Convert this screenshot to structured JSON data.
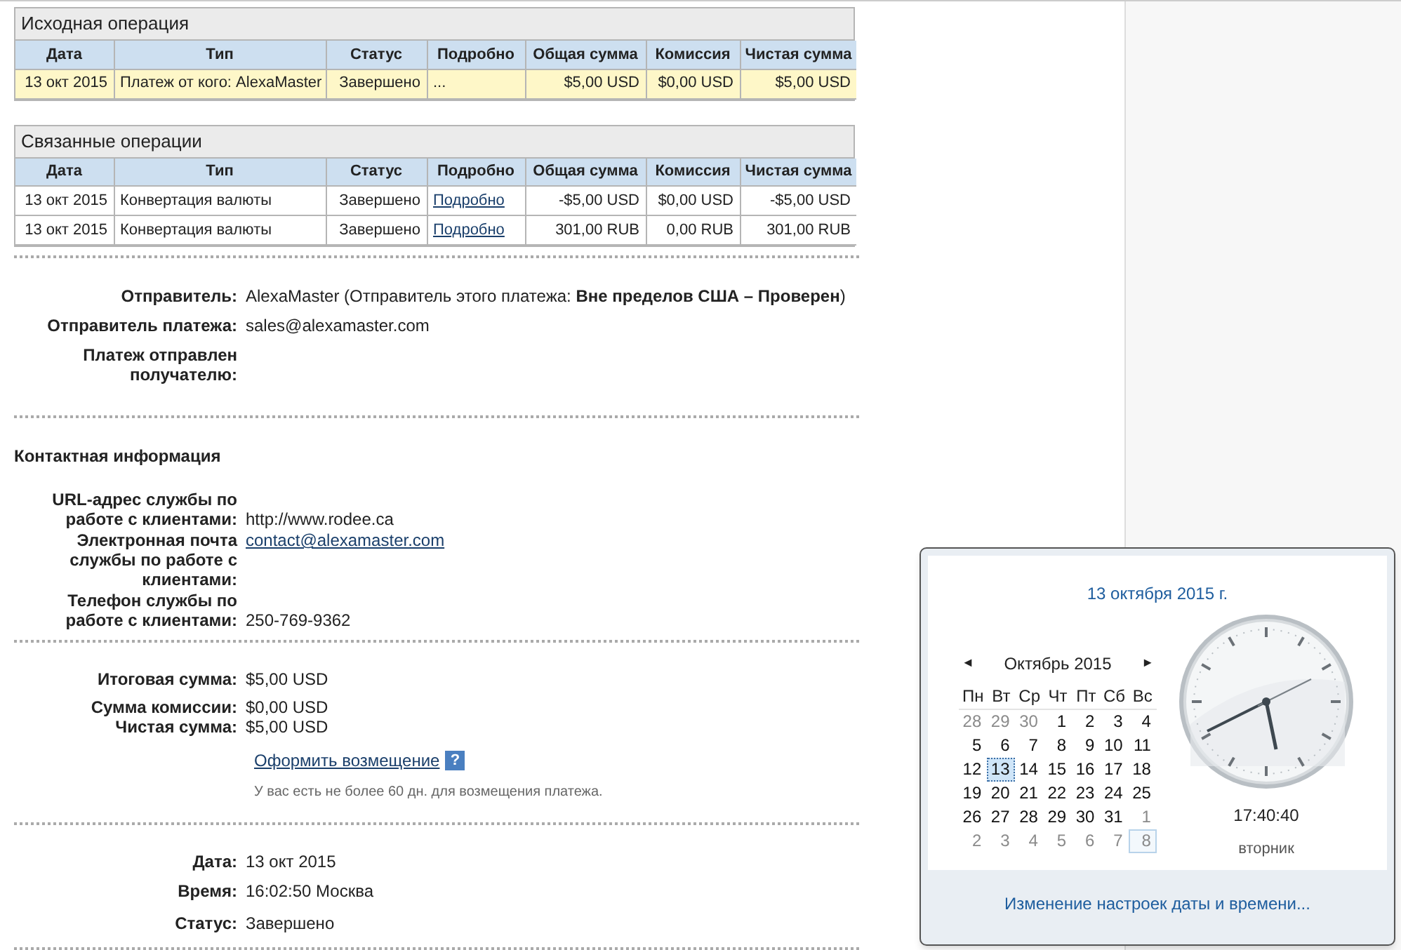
{
  "tables": [
    {
      "title": "Исходная операция",
      "columns": [
        "Дата",
        "Тип",
        "Статус",
        "Подробно",
        "Общая сумма",
        "Комиссия",
        "Чистая сумма"
      ],
      "rows": [
        {
          "selected": true,
          "cells": [
            "13 окт 2015",
            "Платеж от кого: AlexaMaster",
            "Завершено",
            "...",
            "$5,00 USD",
            "$0,00 USD",
            "$5,00 USD"
          ],
          "details_link": false
        }
      ]
    },
    {
      "title": "Связанные операции",
      "columns": [
        "Дата",
        "Тип",
        "Статус",
        "Подробно",
        "Общая сумма",
        "Комиссия",
        "Чистая сумма"
      ],
      "rows": [
        {
          "selected": false,
          "cells": [
            "13 окт 2015",
            "Конвертация валюты",
            "Завершено",
            "Подробно",
            "-$5,00 USD",
            "$0,00 USD",
            "-$5,00 USD"
          ],
          "details_link": true
        },
        {
          "selected": false,
          "cells": [
            "13 окт 2015",
            "Конвертация валюты",
            "Завершено",
            "Подробно",
            "301,00 RUB",
            "0,00 RUB",
            "301,00 RUB"
          ],
          "details_link": true
        }
      ]
    }
  ],
  "sender_section": [
    {
      "label": "Отправитель:",
      "value": "AlexaMaster (Отправитель этого платежа: **Вне пределов США – Проверен**)"
    },
    {
      "label": "Отправитель платежа:",
      "value": "sales@alexamaster.com"
    },
    {
      "label": "Платеж отправлен получателю:"
    }
  ],
  "contact": {
    "heading": "Контактная информация",
    "rows": [
      {
        "label": "URL-адрес службы по работе с клиентами:",
        "value": "http://www.rodee.ca",
        "link": false
      },
      {
        "label": "Электронная почта службы по работе с клиентами:",
        "value": "contact@alexamaster.com",
        "link": true
      },
      {
        "label": "Телефон службы по работе с клиентами:",
        "value": "250-769-9362",
        "link": false
      }
    ]
  },
  "totals": [
    {
      "label": "Итоговая сумма:",
      "value": "$5,00 USD"
    },
    {
      "label": "Сумма комиссии:",
      "value": "$0,00 USD"
    },
    {
      "label": "Чистая сумма:",
      "value": "$5,00 USD"
    }
  ],
  "refund": {
    "link": "Оформить возмещение",
    "help": "?",
    "note": "У вас есть не более 60 дн. для возмещения платежа."
  },
  "info": [
    {
      "label": "Дата:",
      "value": "13 окт 2015"
    },
    {
      "label": "Время:",
      "value": "16:02:50 Москва"
    },
    {
      "label": "Статус:",
      "value": "Завершено"
    }
  ],
  "calendar_popup": {
    "date_title": "13 октября 2015 г.",
    "prev": "◄",
    "month": "Октябрь 2015",
    "next": "►",
    "weekdays": [
      "Пн",
      "Вт",
      "Ср",
      "Чт",
      "Пт",
      "Сб",
      "Вс"
    ],
    "days": [
      {
        "text": "28",
        "other_month": true,
        "selected": false,
        "boxed": false
      },
      {
        "text": "29",
        "other_month": true,
        "selected": false,
        "boxed": false
      },
      {
        "text": "30",
        "other_month": true,
        "selected": false,
        "boxed": false
      },
      {
        "text": "1",
        "other_month": false,
        "selected": false,
        "boxed": false
      },
      {
        "text": "2",
        "other_month": false,
        "selected": false,
        "boxed": false
      },
      {
        "text": "3",
        "other_month": false,
        "selected": false,
        "boxed": false
      },
      {
        "text": "4",
        "other_month": false,
        "selected": false,
        "boxed": false
      },
      {
        "text": "5",
        "other_month": false,
        "selected": false,
        "boxed": false
      },
      {
        "text": "6",
        "other_month": false,
        "selected": false,
        "boxed": false
      },
      {
        "text": "7",
        "other_month": false,
        "selected": false,
        "boxed": false
      },
      {
        "text": "8",
        "other_month": false,
        "selected": false,
        "boxed": false
      },
      {
        "text": "9",
        "other_month": false,
        "selected": false,
        "boxed": false
      },
      {
        "text": "10",
        "other_month": false,
        "selected": false,
        "boxed": false
      },
      {
        "text": "11",
        "other_month": false,
        "selected": false,
        "boxed": false
      },
      {
        "text": "12",
        "other_month": false,
        "selected": false,
        "boxed": false
      },
      {
        "text": "13",
        "other_month": false,
        "selected": true,
        "boxed": false
      },
      {
        "text": "14",
        "other_month": false,
        "selected": false,
        "boxed": false
      },
      {
        "text": "15",
        "other_month": false,
        "selected": false,
        "boxed": false
      },
      {
        "text": "16",
        "other_month": false,
        "selected": false,
        "boxed": false
      },
      {
        "text": "17",
        "other_month": false,
        "selected": false,
        "boxed": false
      },
      {
        "text": "18",
        "other_month": false,
        "selected": false,
        "boxed": false
      },
      {
        "text": "19",
        "other_month": false,
        "selected": false,
        "boxed": false
      },
      {
        "text": "20",
        "other_month": false,
        "selected": false,
        "boxed": false
      },
      {
        "text": "21",
        "other_month": false,
        "selected": false,
        "boxed": false
      },
      {
        "text": "22",
        "other_month": false,
        "selected": false,
        "boxed": false
      },
      {
        "text": "23",
        "other_month": false,
        "selected": false,
        "boxed": false
      },
      {
        "text": "24",
        "other_month": false,
        "selected": false,
        "boxed": false
      },
      {
        "text": "25",
        "other_month": false,
        "selected": false,
        "boxed": false
      },
      {
        "text": "26",
        "other_month": false,
        "selected": false,
        "boxed": false
      },
      {
        "text": "27",
        "other_month": false,
        "selected": false,
        "boxed": false
      },
      {
        "text": "28",
        "other_month": false,
        "selected": false,
        "boxed": false
      },
      {
        "text": "29",
        "other_month": false,
        "selected": false,
        "boxed": false
      },
      {
        "text": "30",
        "other_month": false,
        "selected": false,
        "boxed": false
      },
      {
        "text": "31",
        "other_month": false,
        "selected": false,
        "boxed": false
      },
      {
        "text": "1",
        "other_month": true,
        "selected": false,
        "boxed": false
      },
      {
        "text": "2",
        "other_month": true,
        "selected": false,
        "boxed": false
      },
      {
        "text": "3",
        "other_month": true,
        "selected": false,
        "boxed": false
      },
      {
        "text": "4",
        "other_month": true,
        "selected": false,
        "boxed": false
      },
      {
        "text": "5",
        "other_month": true,
        "selected": false,
        "boxed": false
      },
      {
        "text": "6",
        "other_month": true,
        "selected": false,
        "boxed": false
      },
      {
        "text": "7",
        "other_month": true,
        "selected": false,
        "boxed": false
      },
      {
        "text": "8",
        "other_month": true,
        "selected": false,
        "boxed": true
      }
    ],
    "time": "17:40:40",
    "weekday": "вторник",
    "settings_link": "Изменение настроек даты и времени..."
  }
}
